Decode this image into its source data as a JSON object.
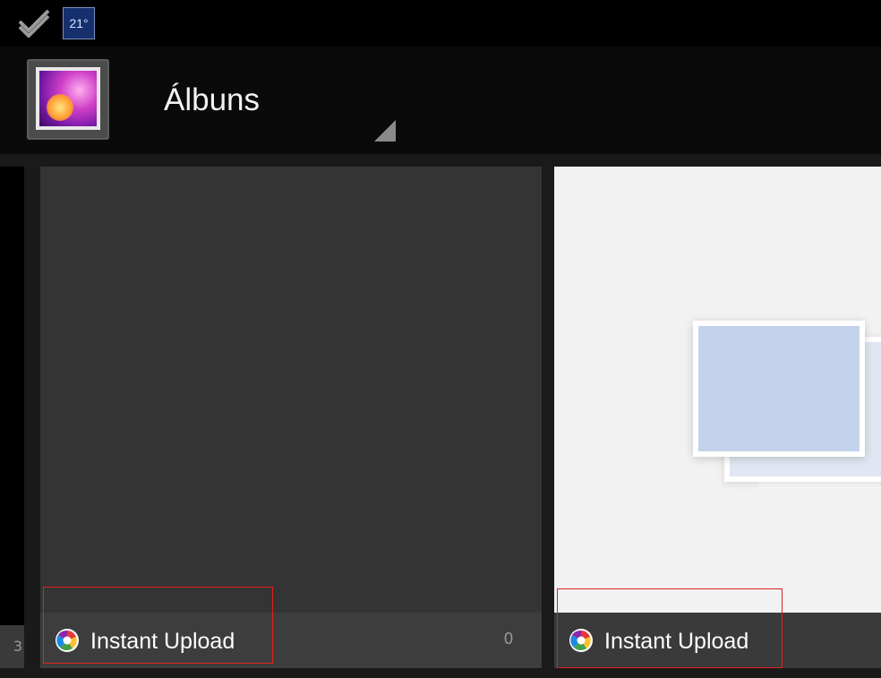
{
  "status_bar": {
    "weather_temp": "21°",
    "icons": [
      "check-notification-icon",
      "weather-icon"
    ]
  },
  "action_bar": {
    "app_icon": "gallery-icon",
    "title": "Álbuns"
  },
  "albums": [
    {
      "name": "",
      "count": "3",
      "partial": true
    },
    {
      "name": "Instant Upload",
      "count": "0",
      "icon": "picasa-icon",
      "thumbnail": "dark-empty"
    },
    {
      "name": "Instant Upload",
      "count": "",
      "icon": "picasa-icon",
      "thumbnail": "photo-stack-placeholder"
    }
  ],
  "colors": {
    "highlight": "#e02020",
    "status_bar_bg": "#000000",
    "action_bar_bg": "#0a0a0a",
    "tile_footer_bg": "#3d3d3d"
  }
}
